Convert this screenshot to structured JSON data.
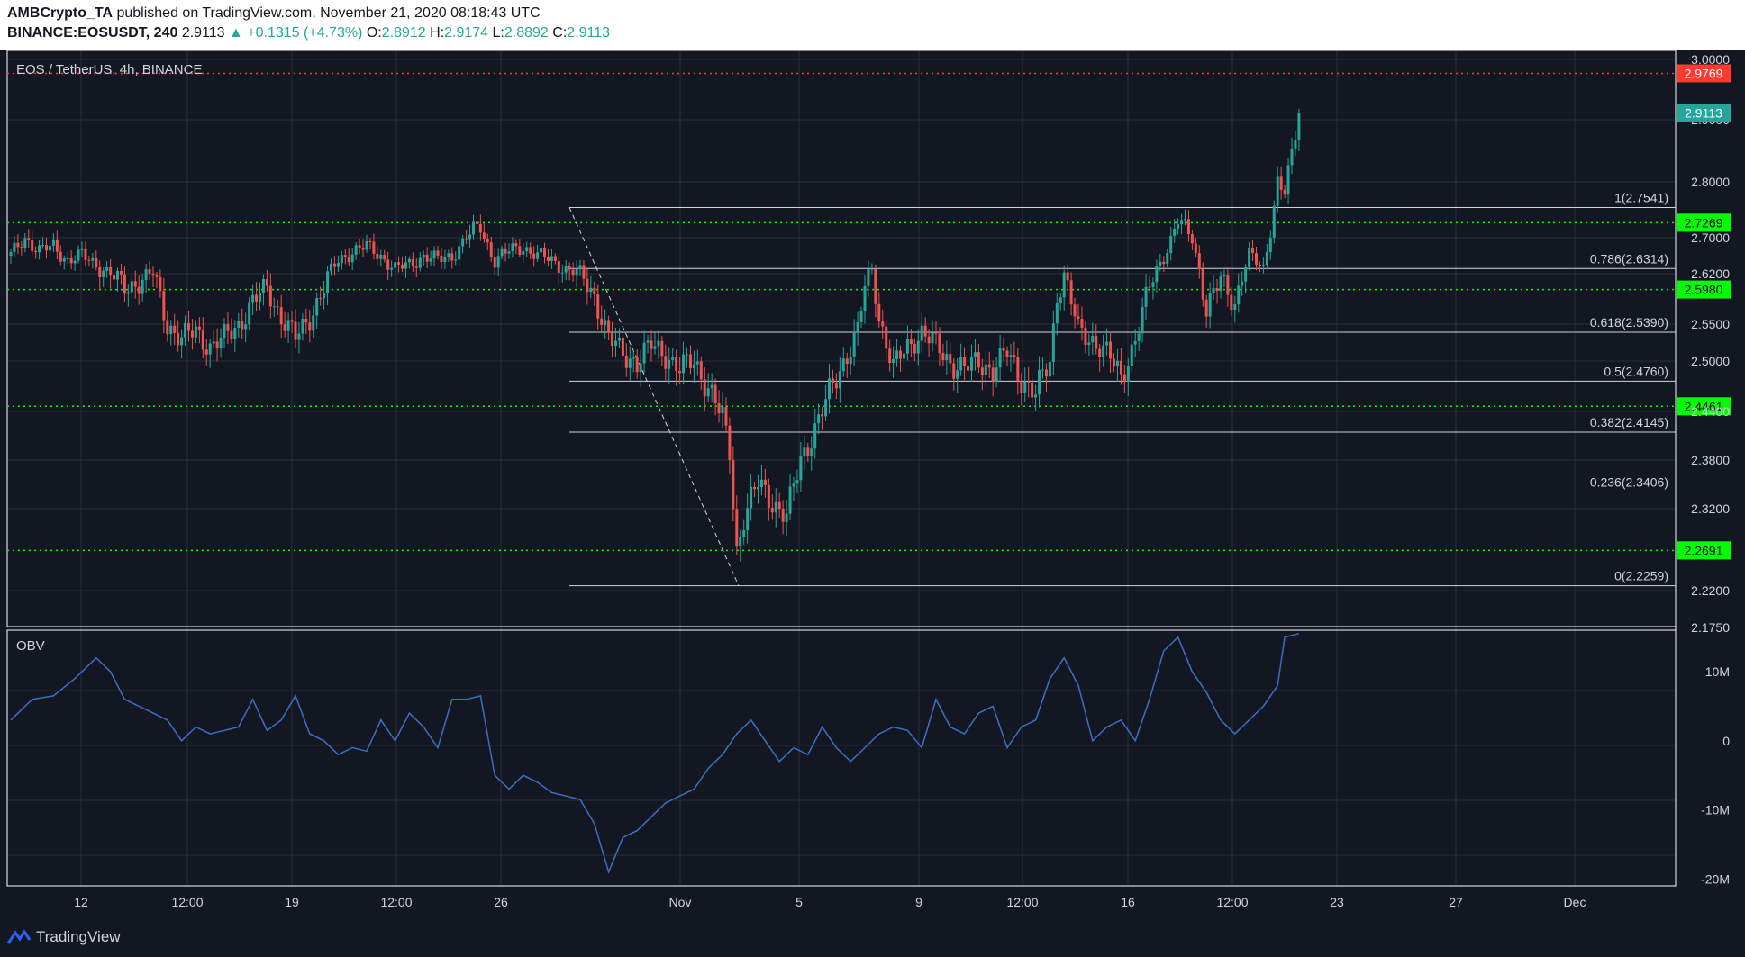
{
  "header": {
    "publisher": "AMBCrypto_TA",
    "published_text": " published on TradingView.com, November 21, 2020 08:18:43 UTC",
    "symbol": "BINANCE:EOSUSDT, 240",
    "last": "2.9113",
    "change": "▲ +0.1315 (+4.73%)",
    "o_label": "O:",
    "o": "2.8912",
    "h_label": "H:",
    "h": "2.9174",
    "l_label": "L:",
    "l": "2.8892",
    "c_label": "C:",
    "c": "2.9113"
  },
  "chart_title": "EOS / TetherUS, 4h, BINANCE",
  "obv_label": "OBV",
  "footer": {
    "brand": "TradingView",
    "logo_icon": "tradingview-logo-icon"
  },
  "colors": {
    "up": "#26a69a",
    "down": "#ef5350",
    "bg": "#131722",
    "grid": "#2a2e39",
    "support": "#00ff00",
    "resistance": "#ff3b30",
    "obv": "#3d6fc4"
  },
  "chart_data": [
    {
      "type": "candlestick",
      "title": "EOS / TetherUS, 4h, BINANCE",
      "ylim": [
        2.175,
        3.0
      ],
      "y_ticks": [
        "3.0000",
        "2.9000",
        "2.8000",
        "2.7000",
        "2.6200",
        "2.5500",
        "2.5000",
        "2.4400",
        "2.3800",
        "2.3200",
        "2.2200",
        "2.1750"
      ],
      "x_ticks": [
        "12",
        "12:00",
        "19",
        "12:00",
        "26",
        "Nov",
        "5",
        "9",
        "12:00",
        "16",
        "12:00",
        "23",
        "27",
        "Dec"
      ],
      "last_price": "2.9113",
      "horizontal_levels": [
        {
          "value": 2.9769,
          "label": "2.9769",
          "style": "resistance"
        },
        {
          "value": 2.7269,
          "label": "2.7269",
          "style": "support"
        },
        {
          "value": 2.598,
          "label": "2.5980",
          "style": "support"
        },
        {
          "value": 2.4461,
          "label": "2.4461",
          "style": "support"
        },
        {
          "value": 2.2691,
          "label": "2.2691",
          "style": "support"
        }
      ],
      "fibonacci": [
        {
          "value": 2.7541,
          "label": "1(2.7541)"
        },
        {
          "value": 2.6314,
          "label": "0.786(2.6314)"
        },
        {
          "value": 2.539,
          "label": "0.618(2.5390)"
        },
        {
          "value": 2.476,
          "label": "0.5(2.4760)"
        },
        {
          "value": 2.4145,
          "label": "0.382(2.4145)"
        },
        {
          "value": 2.3406,
          "label": "0.236(2.3406)"
        },
        {
          "value": 2.2259,
          "label": "0(2.2259)"
        }
      ],
      "close_path": [
        [
          0,
          2.66
        ],
        [
          4,
          2.7
        ],
        [
          8,
          2.67
        ],
        [
          12,
          2.68
        ],
        [
          16,
          2.65
        ],
        [
          20,
          2.66
        ],
        [
          24,
          2.64
        ],
        [
          28,
          2.62
        ],
        [
          32,
          2.6
        ],
        [
          36,
          2.61
        ],
        [
          40,
          2.62
        ],
        [
          44,
          2.55
        ],
        [
          48,
          2.53
        ],
        [
          52,
          2.54
        ],
        [
          56,
          2.52
        ],
        [
          60,
          2.53
        ],
        [
          64,
          2.55
        ],
        [
          68,
          2.58
        ],
        [
          72,
          2.6
        ],
        [
          76,
          2.56
        ],
        [
          80,
          2.53
        ],
        [
          84,
          2.56
        ],
        [
          88,
          2.6
        ],
        [
          92,
          2.65
        ],
        [
          96,
          2.67
        ],
        [
          100,
          2.68
        ],
        [
          104,
          2.66
        ],
        [
          108,
          2.63
        ],
        [
          112,
          2.64
        ],
        [
          116,
          2.66
        ],
        [
          120,
          2.65
        ],
        [
          124,
          2.66
        ],
        [
          128,
          2.7
        ],
        [
          132,
          2.72
        ],
        [
          136,
          2.65
        ],
        [
          140,
          2.67
        ],
        [
          144,
          2.68
        ],
        [
          148,
          2.66
        ],
        [
          152,
          2.65
        ],
        [
          156,
          2.63
        ],
        [
          160,
          2.62
        ],
        [
          164,
          2.59
        ],
        [
          168,
          2.53
        ],
        [
          172,
          2.51
        ],
        [
          176,
          2.5
        ],
        [
          180,
          2.52
        ],
        [
          184,
          2.51
        ],
        [
          188,
          2.49
        ],
        [
          192,
          2.5
        ],
        [
          196,
          2.47
        ],
        [
          200,
          2.43
        ],
        [
          202,
          2.39
        ],
        [
          204,
          2.27
        ],
        [
          206,
          2.31
        ],
        [
          210,
          2.35
        ],
        [
          214,
          2.33
        ],
        [
          218,
          2.31
        ],
        [
          222,
          2.38
        ],
        [
          226,
          2.42
        ],
        [
          230,
          2.46
        ],
        [
          234,
          2.5
        ],
        [
          238,
          2.54
        ],
        [
          240,
          2.6
        ],
        [
          242,
          2.63
        ],
        [
          244,
          2.56
        ],
        [
          248,
          2.49
        ],
        [
          252,
          2.52
        ],
        [
          256,
          2.54
        ],
        [
          260,
          2.52
        ],
        [
          264,
          2.5
        ],
        [
          268,
          2.49
        ],
        [
          272,
          2.5
        ],
        [
          276,
          2.49
        ],
        [
          280,
          2.51
        ],
        [
          284,
          2.48
        ],
        [
          288,
          2.46
        ],
        [
          292,
          2.5
        ],
        [
          294,
          2.59
        ],
        [
          296,
          2.62
        ],
        [
          298,
          2.58
        ],
        [
          300,
          2.54
        ],
        [
          304,
          2.53
        ],
        [
          308,
          2.51
        ],
        [
          312,
          2.48
        ],
        [
          316,
          2.53
        ],
        [
          320,
          2.6
        ],
        [
          324,
          2.66
        ],
        [
          328,
          2.73
        ],
        [
          332,
          2.7
        ],
        [
          334,
          2.63
        ],
        [
          336,
          2.57
        ],
        [
          340,
          2.61
        ],
        [
          344,
          2.58
        ],
        [
          348,
          2.66
        ],
        [
          352,
          2.63
        ],
        [
          354,
          2.72
        ],
        [
          356,
          2.8
        ],
        [
          358,
          2.78
        ],
        [
          360,
          2.84
        ],
        [
          362,
          2.91
        ]
      ]
    },
    {
      "type": "line",
      "title": "OBV",
      "ylabel": "",
      "y_ticks": [
        "10M",
        "0",
        "-10M",
        "-20M"
      ],
      "ylim": [
        -21000000,
        16000000
      ],
      "x": [
        0,
        6,
        12,
        18,
        24,
        28,
        32,
        36,
        40,
        44,
        48,
        52,
        56,
        60,
        64,
        68,
        72,
        76,
        80,
        84,
        88,
        92,
        96,
        100,
        104,
        108,
        112,
        116,
        120,
        124,
        128,
        132,
        136,
        140,
        144,
        148,
        152,
        156,
        160,
        164,
        168,
        172,
        176,
        180,
        184,
        188,
        192,
        196,
        200,
        204,
        208,
        212,
        216,
        220,
        224,
        228,
        232,
        236,
        240,
        244,
        248,
        252,
        256,
        260,
        264,
        268,
        272,
        276,
        280,
        284,
        288,
        292,
        296,
        300,
        304,
        308,
        312,
        316,
        320,
        324,
        328,
        332,
        336,
        340,
        344,
        348,
        352,
        356,
        358,
        362
      ],
      "values": [
        3000000,
        6000000,
        6500000,
        9000000,
        12000000,
        10000000,
        6000000,
        5000000,
        4000000,
        3000000,
        0,
        2000000,
        1000000,
        1500000,
        2000000,
        6000000,
        1500000,
        3000000,
        6500000,
        1000000,
        0,
        -2000000,
        -1000000,
        -1500000,
        3000000,
        0,
        4000000,
        2000000,
        -1000000,
        6000000,
        6000000,
        6500000,
        -5000000,
        -7000000,
        -5000000,
        -6000000,
        -7500000,
        -8000000,
        -8500000,
        -12000000,
        -19000000,
        -14000000,
        -13000000,
        -11000000,
        -9000000,
        -8000000,
        -7000000,
        -4000000,
        -2000000,
        1000000,
        3000000,
        0,
        -3000000,
        -1000000,
        -2000000,
        2000000,
        -1000000,
        -3000000,
        -1000000,
        1000000,
        2000000,
        1500000,
        -1000000,
        6000000,
        2000000,
        1000000,
        4000000,
        5000000,
        -1000000,
        2000000,
        3000000,
        9000000,
        12000000,
        8000000,
        0,
        2000000,
        3000000,
        0,
        6000000,
        13000000,
        15000000,
        10000000,
        7000000,
        3000000,
        1000000,
        3000000,
        5000000,
        8000000,
        15000000,
        15500000
      ]
    }
  ]
}
